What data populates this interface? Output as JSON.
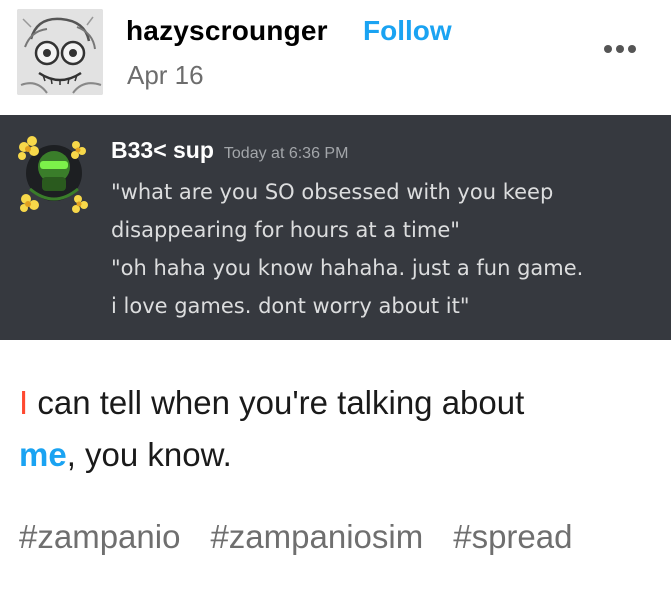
{
  "post": {
    "username": "hazyscrounger",
    "follow_label": "Follow",
    "date": "Apr 16",
    "avatar_icon": "sketch-avatar-icon",
    "more_icon": "ellipsis-icon"
  },
  "discord": {
    "author": "B33< sup",
    "timestamp": "Today at 6:36 PM",
    "avatar_icon": "flower-avatar-icon",
    "lines": [
      "\"what are you SO obsessed with you keep",
      "disappearing for hours at a time\"",
      "\"oh haha you know hahaha. just a fun game.",
      "i love games. dont worry about it\""
    ]
  },
  "reply": {
    "line1_highlight": "I",
    "line1_rest": " can tell when you're talking about",
    "line2_highlight": "me",
    "line2_rest": ", you know."
  },
  "tags": [
    "#zampanio",
    "#zampaniosim",
    "#spread"
  ],
  "colors": {
    "follow": "#1aa3f2",
    "highlight_red": "#ff4930",
    "highlight_blue": "#1aa3f2",
    "discord_bg": "#36393f"
  }
}
